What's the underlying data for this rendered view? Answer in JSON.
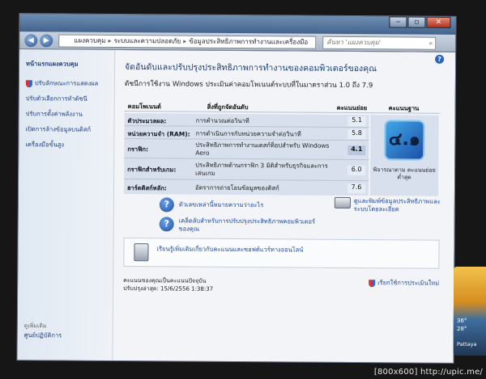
{
  "window": {
    "controls": {
      "minimize": "‒",
      "maximize": "▫",
      "close": "✕"
    }
  },
  "address": {
    "crumbs": [
      "แผงควบคุม",
      "ระบบและความปลอดภัย",
      "ข้อมูลประสิทธิภาพการทำงานและเครื่องมือ"
    ],
    "search_placeholder": "ค้นหา 'แผงควบคุม'"
  },
  "sidebar": {
    "home": "หน้าแรกแผงควบคุม",
    "items": [
      "ปรับลักษณะการแสดงผล",
      "ปรับตัวเลือกการทำดัชนี",
      "ปรับการตั้งค่าพลังงาน",
      "เปิดการล้างข้อมูลบนดิสก์",
      "เครื่องมือขั้นสูง"
    ],
    "see_also": "ดูเพิ่มเติม",
    "action_center": "ศูนย์ปฏิบัติการ"
  },
  "main": {
    "title": "จัดอันดับและปรับปรุงประสิทธิภาพการทำงานของคอมพิวเตอร์ของคุณ",
    "subtitle": "ดัชนีการใช้งาน Windows ประเมินค่าคอมโพเนนต์ระบบที่ในมาตราส่วน 1.0 ถึง 7.9",
    "table_headers": {
      "component": "คอมโพเนนต์",
      "rated": "สิ่งที่ถูกจัดอันดับ",
      "subscore": "คะแนนย่อย",
      "basescore": "คะแนนฐาน"
    },
    "rows": [
      {
        "component": "ตัวประมวลผล:",
        "desc": "การคำนวณต่อวินาที",
        "score": "5.1"
      },
      {
        "component": "หน่วยความจำ (RAM):",
        "desc": "การดำเนินการกับหน่วยความจำต่อวินาที",
        "score": "5.8"
      },
      {
        "component": "กราฟิก:",
        "desc": "ประสิทธิภาพการทำงานเดสก์ท็อปสำหรับ Windows Aero",
        "score": "4.1"
      },
      {
        "component": "กราฟิกสำหรับเกม:",
        "desc": "ประสิทธิภาพด้านกราฟิก 3 มิติสำหรับธุรกิจและการเล่นเกม",
        "score": "6.0"
      },
      {
        "component": "ฮาร์ดดิสก์หลัก:",
        "desc": "อัตราการถ่ายโอนข้อมูลของดิสก์",
        "score": "7.6"
      }
    ],
    "base_score": "๔.๑",
    "base_score_label": "พิจารณาตาม คะแนนย่อยต่ำสุด",
    "links": {
      "what_means": "ตัวเลขเหล่านี้หมายความว่าอะไร",
      "tips": "เคล็ดลับสำหรับการปรับปรุงประสิทธิภาพคอมพิวเตอร์ของคุณ",
      "print": "ดูและพิมพ์ข้อมูลประสิทธิภาพและระบบโดยละเอียด",
      "learn_more": "เรียนรู้เพิ่มเติมเกี่ยวกับคะแนนและซอฟต์แวร์ทางออนไลน์"
    },
    "status_line1": "คะแนนของคุณเป็นคะแนนปัจจุบัน",
    "status_line2": "ปรับปรุงล่าสุด: 15/6/2556 1:38:37",
    "rerun": "เรียกใช้การประเมินใหม่"
  },
  "gadget": {
    "temp1": "36°",
    "temp2": "28°",
    "city": "Pattaya"
  },
  "watermark": "[800x600] http://upic.me/"
}
